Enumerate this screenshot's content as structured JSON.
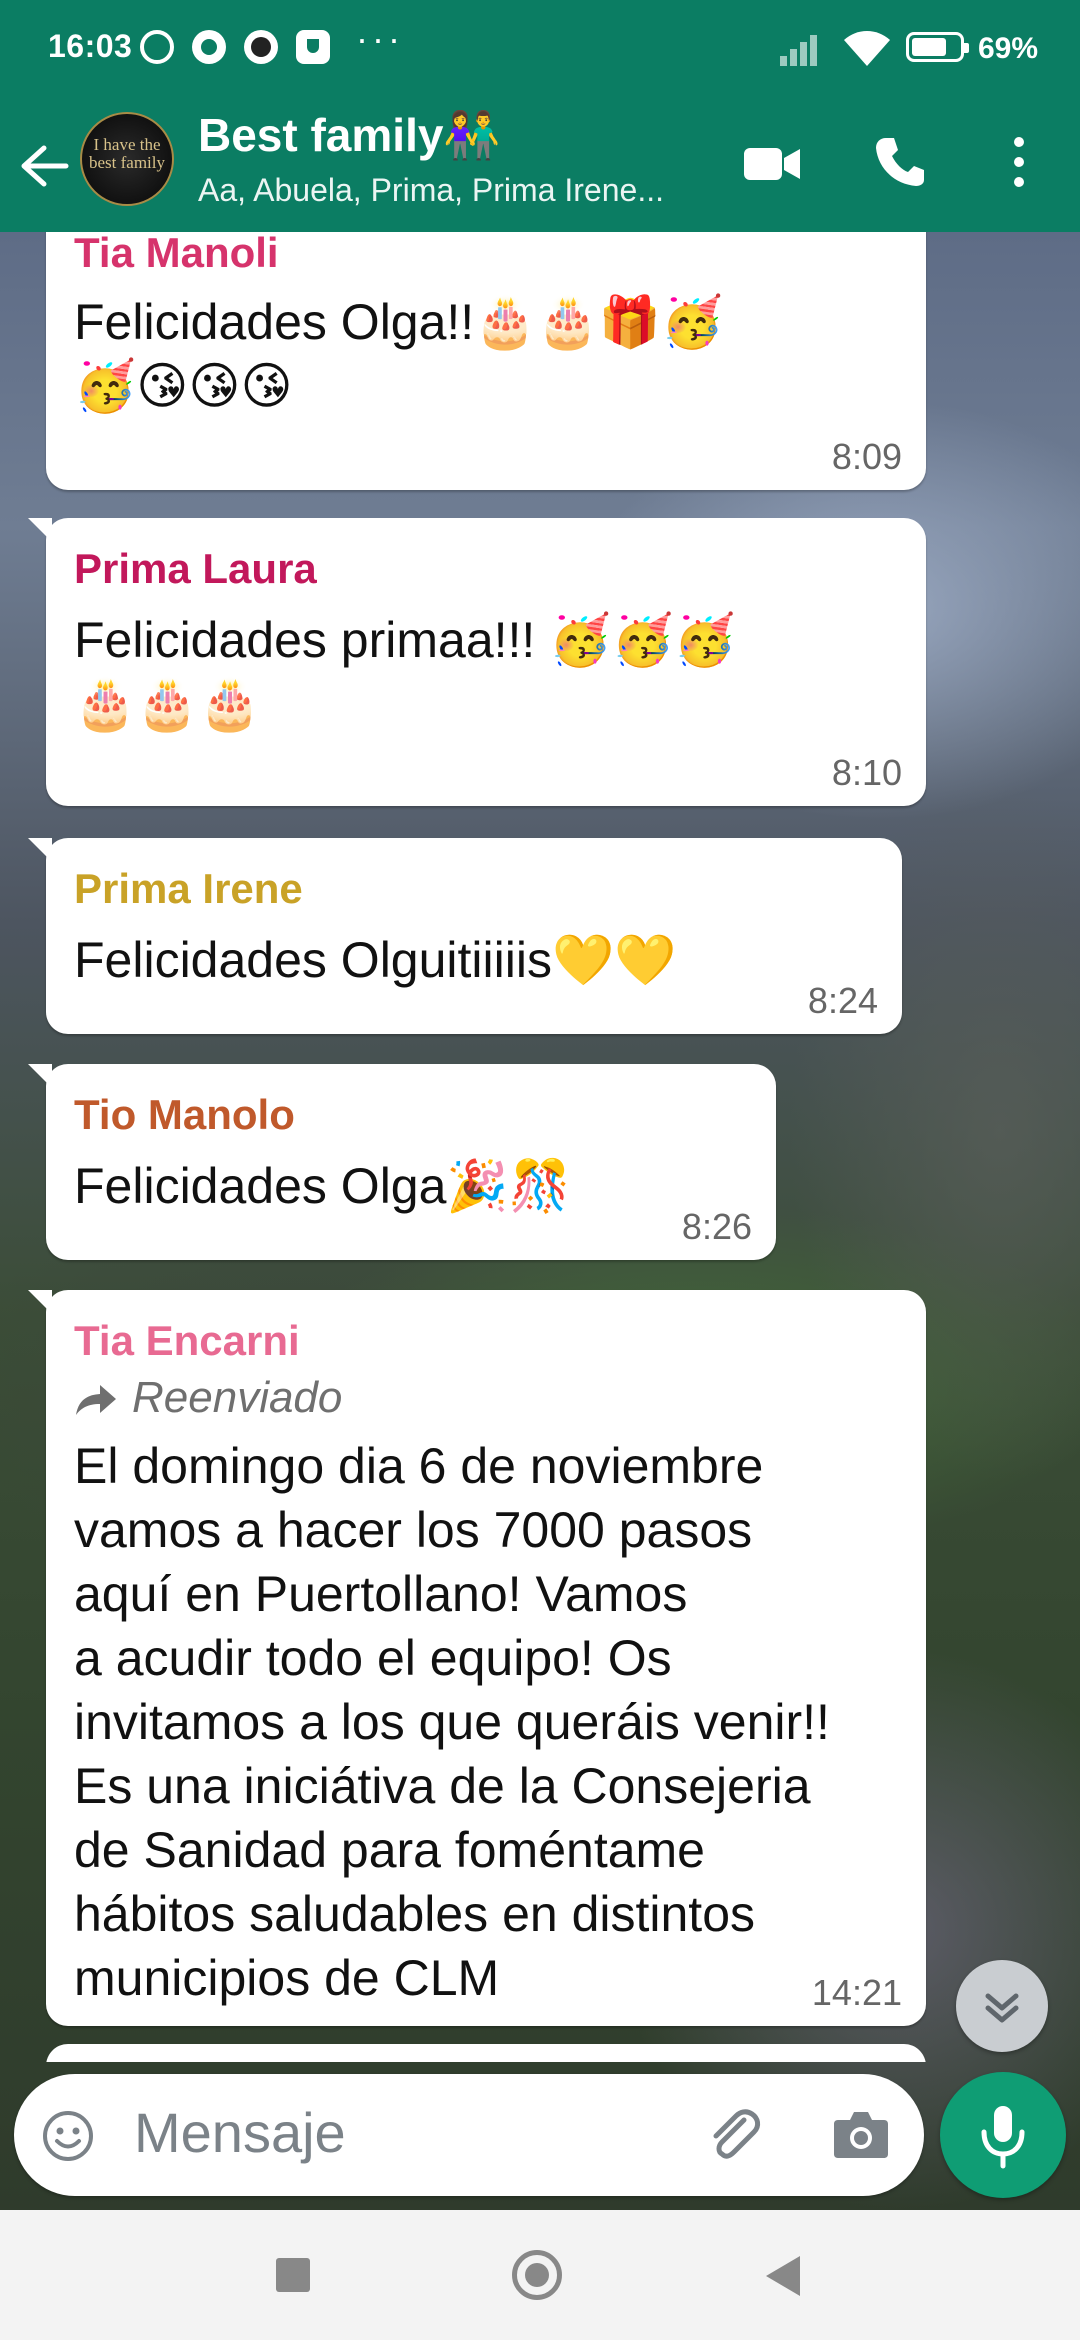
{
  "status_bar": {
    "time": "16:03",
    "more": "···",
    "battery": "69%"
  },
  "header": {
    "title": "Best family👫",
    "members": "Aa, Abuela, Prima, Prima Irene...",
    "avatar_text": "I have the best family"
  },
  "messages": [
    {
      "sender": "Tia Manoli",
      "sender_color": "#d6336c",
      "text": "Felicidades Olga!!🎂🎂🎁🥳\n🥳😘😘😘",
      "time": "8:09"
    },
    {
      "sender": "Prima Laura",
      "sender_color": "#c2185b",
      "text": "Felicidades primaa!!! 🥳🥳🥳\n🎂🎂🎂",
      "time": "8:10"
    },
    {
      "sender": "Prima Irene",
      "sender_color": "#c9a227",
      "text": "Felicidades Olguitiiiiis💛💛",
      "time": "8:24"
    },
    {
      "sender": "Tio Manolo",
      "sender_color": "#c0592b",
      "text": "Felicidades Olga🎉🎊",
      "time": "8:26"
    },
    {
      "sender": "Tia Encarni",
      "sender_color": "#e86a92",
      "forwarded": "Reenviado",
      "text": "El domingo dia 6 de noviembre\nvamos a hacer los 7000 pasos\naquí en Puertollano! Vamos\na acudir todo el equipo! Os\ninvitamos a los que queráis venir!!\nEs una iniciátiva de la Consejeria\nde Sanidad para foméntame\nhábitos saludables en distintos\nmunicipios de CLM",
      "time": "14:21"
    }
  ],
  "input": {
    "placeholder": "Mensaje"
  },
  "colors": {
    "brand": "#0b7d63",
    "mic": "#0f9d74"
  },
  "icons": [
    "back-arrow-icon",
    "video-call-icon",
    "phone-icon",
    "more-vert-icon",
    "emoji-icon",
    "attach-icon",
    "camera-icon",
    "mic-icon",
    "scroll-down-icon",
    "forward-icon"
  ]
}
